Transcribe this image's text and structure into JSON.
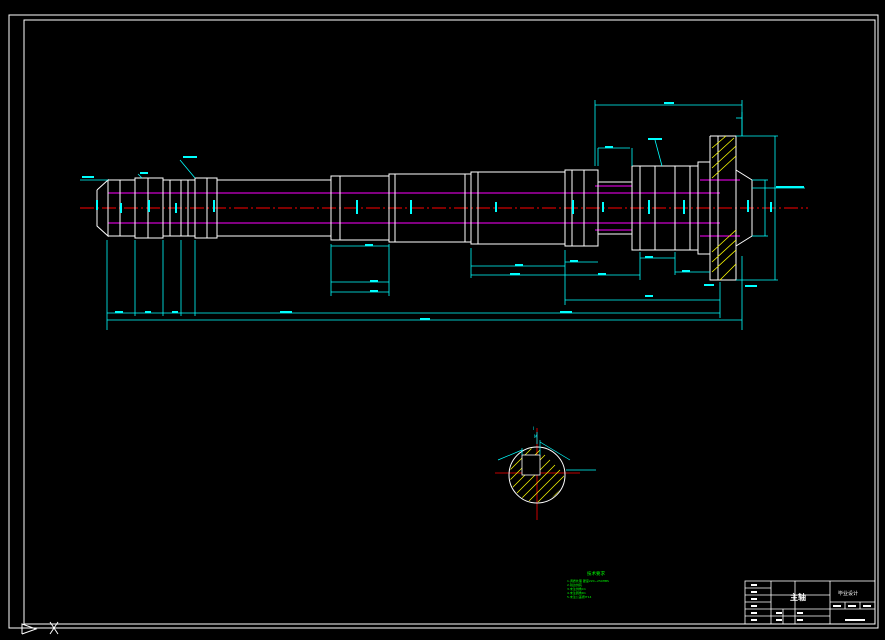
{
  "drawing": {
    "title": "主轴",
    "course_label": "毕业设计",
    "tech_req_heading": "技术要求",
    "tech_req_lines": [
      "1.调质处理 硬度220~250HBS",
      "2.锐边倒钝",
      "3.未注倒角C1",
      "4.未注圆角R1",
      "5.未注公差按IT14"
    ],
    "section_label": "A-A",
    "colors": {
      "frame": "#FFFFFF",
      "outline": "#FFFFFF",
      "dimension": "#00FFFF",
      "hidden": "#FF00FF",
      "centerline": "#FF0000",
      "hatch": "#FFFF00",
      "note": "#00FF00"
    }
  }
}
